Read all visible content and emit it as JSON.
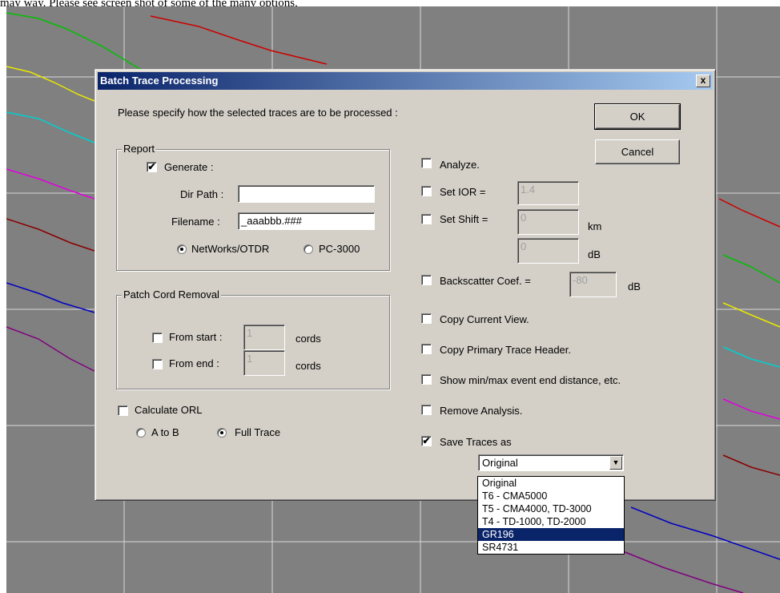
{
  "page": {
    "caption": "may way. Please see screen shot of some of the many options,"
  },
  "dialog": {
    "title": "Batch Trace Processing",
    "close_label": "x",
    "instruction": "Please specify how the selected traces are to be processed :",
    "ok_label": "OK",
    "cancel_label": "Cancel",
    "report": {
      "group_label": "Report",
      "generate_label": "Generate :",
      "generate_checked": true,
      "dir_path_label": "Dir Path :",
      "dir_path_value": "",
      "filename_label": "Filename :",
      "filename_value": "_aaabbb.###",
      "radio_networks_label": "NetWorks/OTDR",
      "radio_pc3000_label": "PC-3000",
      "selected": "NetWorks/OTDR"
    },
    "patch_cord": {
      "group_label": "Patch Cord Removal",
      "from_start_label": "From start :",
      "from_start_value": "1",
      "from_end_label": "From end :",
      "from_end_value": "1",
      "cords_label": "cords"
    },
    "orl": {
      "calculate_label": "Calculate ORL",
      "a_to_b_label": "A to B",
      "full_trace_label": "Full Trace",
      "selected": "Full Trace"
    },
    "options": {
      "analyze_label": "Analyze.",
      "set_ior_label": "Set IOR =",
      "ior_value": "1.4",
      "set_shift_label": "Set Shift =",
      "shift_km_value": "0",
      "km_unit": "km",
      "shift_db_value": "0",
      "db_unit": "dB",
      "backscatter_label": "Backscatter Coef. =",
      "backscatter_value": "-80",
      "backscatter_unit": "dB",
      "copy_view_label": "Copy Current View.",
      "copy_header_label": "Copy Primary Trace Header.",
      "show_minmax_label": "Show min/max event end distance, etc.",
      "remove_analysis_label": "Remove Analysis.",
      "save_traces_label": "Save Traces as",
      "save_traces_checked": true,
      "save_format_value": "Original",
      "save_format_options": [
        "Original",
        "T6 - CMA5000",
        "T5 - CMA4000, TD-3000",
        "T4 - TD-1000, TD-2000",
        "GR196",
        "SR4731"
      ],
      "highlighted_option": "GR196"
    }
  }
}
